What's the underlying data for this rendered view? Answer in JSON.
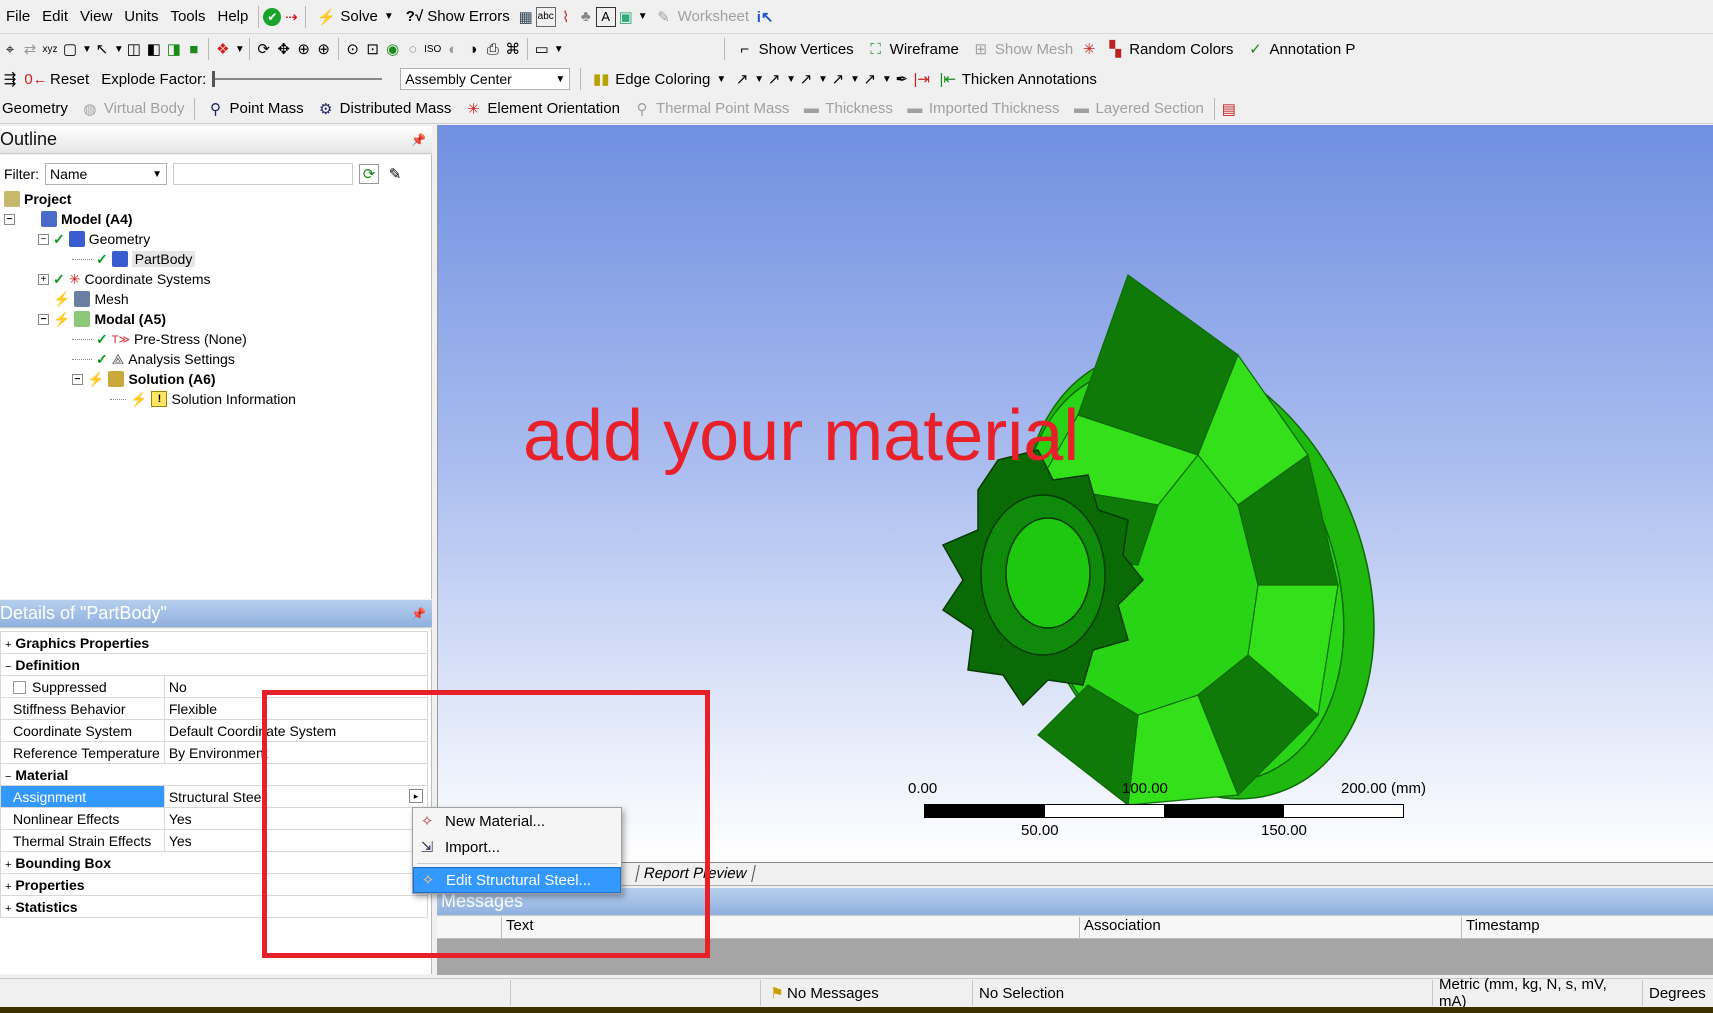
{
  "menubar": [
    "File",
    "Edit",
    "View",
    "Units",
    "Tools",
    "Help"
  ],
  "toolbar1": {
    "solve": "Solve",
    "show_errors": "Show Errors",
    "worksheet": "Worksheet"
  },
  "toolbar2": {
    "show_vertices": "Show Vertices",
    "wireframe": "Wireframe",
    "show_mesh": "Show Mesh",
    "random_colors": "Random Colors",
    "annotation": "Annotation P"
  },
  "toolbar3": {
    "reset": "Reset",
    "explode_factor": "Explode Factor:",
    "assembly_center": "Assembly Center",
    "edge_coloring": "Edge Coloring",
    "thicken_annotations": "Thicken Annotations"
  },
  "toolbar4": {
    "geometry": "Geometry",
    "virtual_body": "Virtual Body",
    "point_mass": "Point Mass",
    "distributed_mass": "Distributed Mass",
    "element_orientation": "Element Orientation",
    "thermal_point_mass": "Thermal Point Mass",
    "thickness": "Thickness",
    "imported_thickness": "Imported Thickness",
    "layered_section": "Layered Section"
  },
  "outline": {
    "title": "Outline",
    "filter_label": "Filter:",
    "filter_value": "Name",
    "tree": {
      "project": "Project",
      "model": "Model (A4)",
      "geometry": "Geometry",
      "partbody": "PartBody",
      "coordinate_systems": "Coordinate Systems",
      "mesh": "Mesh",
      "modal": "Modal (A5)",
      "prestress": "Pre-Stress (None)",
      "analysis_settings": "Analysis Settings",
      "solution": "Solution (A6)",
      "solution_information": "Solution Information"
    }
  },
  "details": {
    "title": "Details of \"PartBody\"",
    "graphics_properties": "Graphics Properties",
    "definition": "Definition",
    "suppressed": {
      "label": "Suppressed",
      "value": "No"
    },
    "stiffness": {
      "label": "Stiffness Behavior",
      "value": "Flexible"
    },
    "coord_system": {
      "label": "Coordinate System",
      "value": "Default Coordinate System"
    },
    "ref_temp": {
      "label": "Reference Temperature",
      "value": "By Environment"
    },
    "material": "Material",
    "assignment": {
      "label": "Assignment",
      "value": "Structural Steel"
    },
    "nonlinear": {
      "label": "Nonlinear Effects",
      "value": "Yes"
    },
    "thermal_strain": {
      "label": "Thermal Strain Effects",
      "value": "Yes"
    },
    "bounding_box": "Bounding Box",
    "properties": "Properties",
    "statistics": "Statistics"
  },
  "context_menu": {
    "new_material": "New Material...",
    "import": "Import...",
    "edit_material": "Edit Structural Steel..."
  },
  "viewport": {
    "annotation_text": "add your material",
    "annotation_color": "#e8202a",
    "model_color": "#22dd11",
    "bg_top": "#6f8fe0",
    "bg_bottom": "#ffffff",
    "scale": {
      "top_labels": [
        "0.00",
        "100.00",
        "200.00 (mm)"
      ],
      "bottom_labels": [
        "50.00",
        "150.00"
      ]
    }
  },
  "tabs": {
    "report_preview": "Report Preview"
  },
  "messages": {
    "title": "Messages",
    "columns": [
      "Text",
      "Association",
      "Timestamp"
    ]
  },
  "statusbar": {
    "no_messages": "No Messages",
    "no_selection": "No Selection",
    "units": "Metric (mm, kg, N, s, mV, mA)",
    "degrees": "Degrees"
  }
}
